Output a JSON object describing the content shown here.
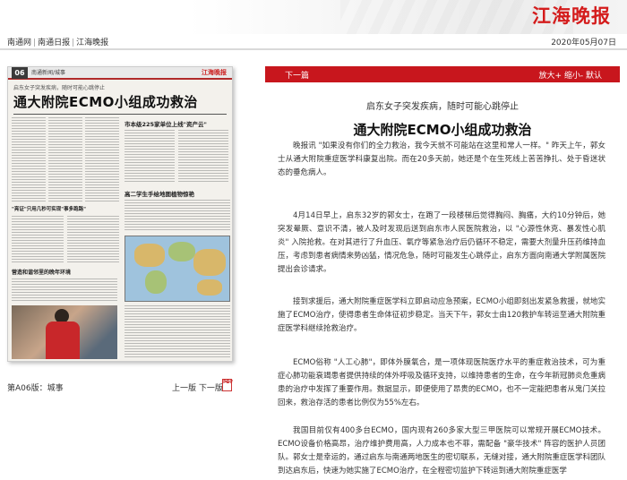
{
  "brand": {
    "logo_text": "江海晚报",
    "date": "2020年05月07日",
    "accent": "#c8161d"
  },
  "nav": {
    "items": [
      "南通网",
      "南通日报",
      "江海晚报"
    ],
    "separator": "|"
  },
  "thumbnail": {
    "section_number": "06",
    "section_name": "南通新闻/城事",
    "mini_logo": "江海晚报",
    "kicker": "启东女子突发疾病，随时可能心跳停止",
    "headline": "通大附院ECMO小组成功救治",
    "sub1": "市本级225家单位上线\"资产云\"",
    "sub2": "高二学生手绘地图植物惊艳",
    "sub3": "\"亮证\"只用几秒可实现\"事多跑路\"",
    "sub4": "营造和谐邻里的晚年环境"
  },
  "page_label": "第A06版：城事",
  "pager": {
    "prev": "上一版",
    "next": "下一版"
  },
  "pdf_icon": "pdf-icon",
  "toolbar": {
    "next_article": "下一篇",
    "zoom_in": "放大+",
    "zoom_out": "缩小-",
    "default": "默认"
  },
  "article": {
    "kicker": "启东女子突发疾病，随时可能心跳停止",
    "headline": "通大附院ECMO小组成功救治",
    "paragraphs": [
      "晚报讯 \"如果没有你们的全力救治，我今天就不可能站在这里和常人一样。\" 昨天上午，郭女士从通大附院重症医学科康复出院。而在20多天前，她还是个在生死线上苦苦挣扎、处于昏迷状态的垂危病人。",
      "4月14日早上，启东32岁的郭女士，在跑了一段楼梯后觉得胸闷、胸痛，大约10分钟后，她突发晕厥、意识不清，被人及时发现后送到启东市人民医院救治，以 \"心源性休克、暴发性心肌炎\" 入院抢救。在对其进行了升血压、氧疗等紧急治疗后仍循环不稳定，需要大剂量升压药维持血压，考虑到患者病情来势凶猛，情况危急，随时可能发生心跳停止，启东方面向南通大学附属医院提出会诊请求。",
      "接到求援后，通大附院重症医学科立即启动应急预案，ECMO小组即刻出发紧急救援，就地实施了ECMO治疗，使得患者生命体征初步稳定。当天下午，郭女士由120救护车转运至通大附院重症医学科继续抢救治疗。",
      "ECMO俗称 \"人工心肺\"，即体外膜氧合，是一项体现医院医疗水平的重症救治技术，可为重症心肺功能衰竭患者提供持续的体外呼吸及循环支持，以维持患者的生命，在今年新冠肺炎危重病患的治疗中发挥了重要作用。数据显示，即便使用了昂贵的ECMO，也不一定能把患者从鬼门关拉回来，救治存活的患者比例仅为55%左右。",
      "我国目前仅有400多台ECMO，国内现有260多家大型三甲医院可以常规开展ECMO技术。ECMO设备价格高昂，治疗维护费用高，人力成本也不菲，需配备 \"豪华技术\" 阵容的医护人员团队。郭女士是幸运的，通过启东与南通两地医生的密切联系，无缝对接，通大附院重症医学科团队到达启东后，快速为她实施了ECMO治疗，在全程密切监护下转运到通大附院重症医学"
    ]
  }
}
